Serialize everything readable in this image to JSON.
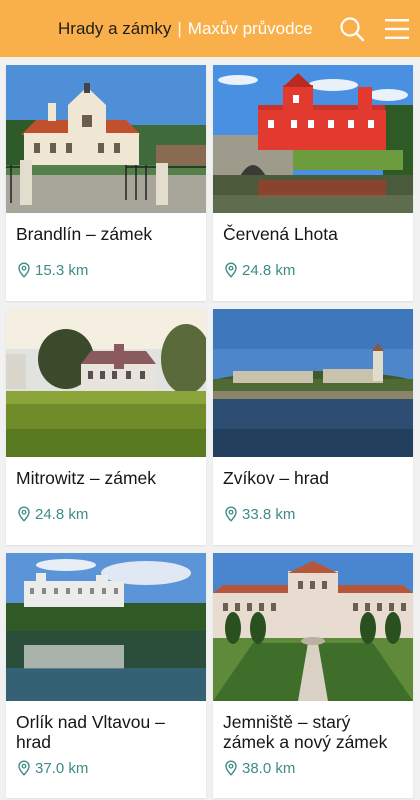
{
  "header": {
    "title": "Hrady a zámky",
    "separator": "|",
    "subtitle": "Maxův průvodce",
    "search_icon": "search-icon",
    "menu_icon": "hamburger-menu-icon",
    "background_color": "#f9b04a"
  },
  "places": [
    {
      "name": "Brandlín – zámek",
      "distance": "15.3 km"
    },
    {
      "name": "Červená Lhota",
      "distance": "24.8 km"
    },
    {
      "name": "Mitrowitz – zámek",
      "distance": "24.8 km"
    },
    {
      "name": "Zvíkov – hrad",
      "distance": "33.8 km"
    },
    {
      "name": "Orlík nad Vltavou – hrad",
      "distance": "37.0 km"
    },
    {
      "name": "Jemniště – starý zámek a nový zámek",
      "distance": "38.0 km"
    }
  ],
  "distance_icon": "location-pin-icon",
  "distance_color": "#3e8c86"
}
